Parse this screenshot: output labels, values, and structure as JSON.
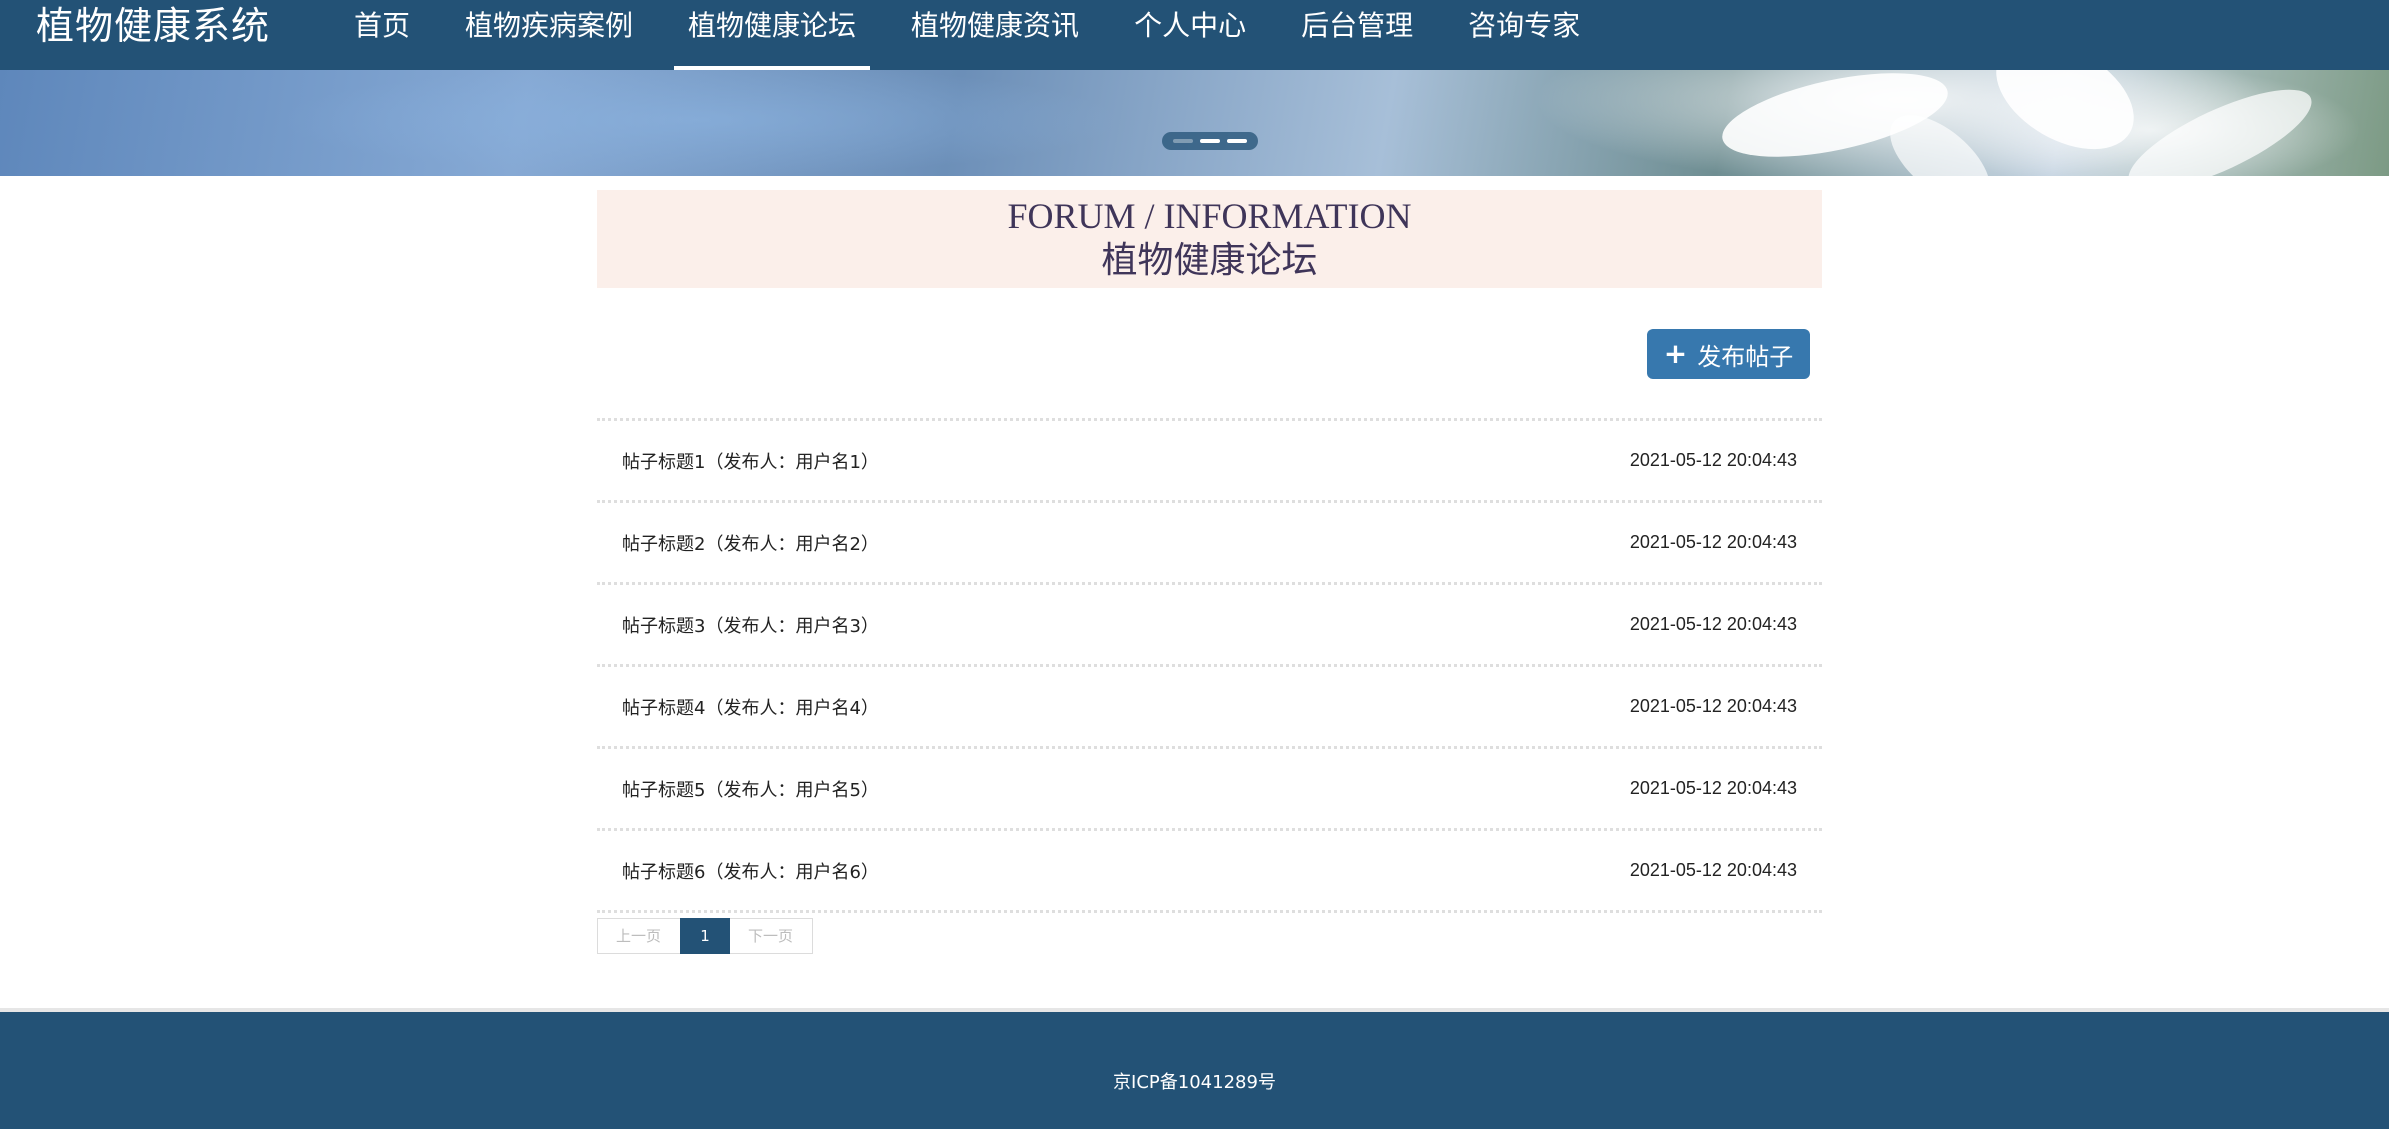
{
  "header": {
    "brand": "植物健康系统",
    "nav": [
      {
        "label": "首页",
        "active": false
      },
      {
        "label": "植物疾病案例",
        "active": false
      },
      {
        "label": "植物健康论坛",
        "active": true
      },
      {
        "label": "植物健康资讯",
        "active": false
      },
      {
        "label": "个人中心",
        "active": false
      },
      {
        "label": "后台管理",
        "active": false
      },
      {
        "label": "咨询专家",
        "active": false
      }
    ]
  },
  "banner": {
    "slides": 3,
    "active_index": 1
  },
  "section": {
    "title_en": "FORUM / INFORMATION",
    "title_cn": "植物健康论坛"
  },
  "toolbar": {
    "publish_icon": "+",
    "publish_label": "发布帖子"
  },
  "posts": [
    {
      "title": "帖子标题1（发布人：用户名1）",
      "time": "2021-05-12 20:04:43"
    },
    {
      "title": "帖子标题2（发布人：用户名2）",
      "time": "2021-05-12 20:04:43"
    },
    {
      "title": "帖子标题3（发布人：用户名3）",
      "time": "2021-05-12 20:04:43"
    },
    {
      "title": "帖子标题4（发布人：用户名4）",
      "time": "2021-05-12 20:04:43"
    },
    {
      "title": "帖子标题5（发布人：用户名5）",
      "time": "2021-05-12 20:04:43"
    },
    {
      "title": "帖子标题6（发布人：用户名6）",
      "time": "2021-05-12 20:04:43"
    }
  ],
  "pagination": {
    "prev_label": "上一页",
    "current_page": "1",
    "next_label": "下一页"
  },
  "footer": {
    "icp": "京ICP备1041289号"
  },
  "colors": {
    "primary": "#235276",
    "button": "#3778ae",
    "title_bg": "#fbefea",
    "title_text": "#3f3559"
  }
}
